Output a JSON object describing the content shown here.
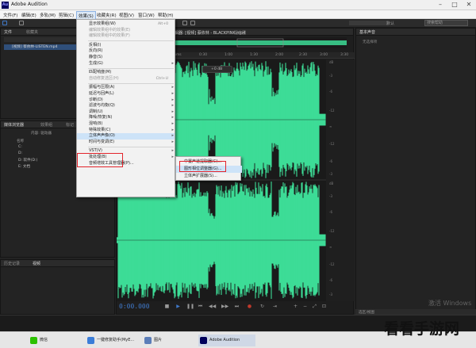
{
  "window": {
    "title": "Adobe Audition",
    "app_logo": "Au",
    "minimize": "–",
    "maximize": "□",
    "close": "✕"
  },
  "menubar": [
    {
      "label": "文件(F)"
    },
    {
      "label": "编辑(E)"
    },
    {
      "label": "多轨(M)"
    },
    {
      "label": "剪辑(C)"
    },
    {
      "label": "效果(S)"
    },
    {
      "label": "收藏夹(R)"
    },
    {
      "label": "视图(V)"
    },
    {
      "label": "窗口(W)"
    },
    {
      "label": "帮助(H)"
    }
  ],
  "toolbar": {
    "workspace": "默认",
    "search": "搜索帮助"
  },
  "files_panel": {
    "tabs": [
      "文件",
      "收藏夹"
    ],
    "file_item": "[视频] 蔡依林-LISTEN.mp4"
  },
  "media_panel": {
    "tabs": [
      "媒体浏览器",
      "效果组",
      "标记"
    ],
    "column_header": "内容: 驱动器",
    "tree": [
      "名称",
      "C:",
      "D:",
      "D: 软件(D:)",
      "E: 文档"
    ]
  },
  "history_panel": {
    "tabs": [
      "历史记录",
      "视频"
    ]
  },
  "editor": {
    "file_tab": "编辑器: [视频] 蔡依林 - BLACKPINK.mp4",
    "mixer_tab": "混音器",
    "timecode": "0:00.000",
    "zoom": "+0 dB",
    "ruler": [
      "hms",
      "0:30",
      "1:00",
      "1:30",
      "2:00",
      "2:30",
      "3:00",
      "3:30"
    ],
    "db_scale": [
      "dB",
      "-3",
      "-6",
      "-12",
      "∞",
      "-12",
      "-6",
      "-3",
      "dB",
      "-3",
      "-6",
      "-12",
      "∞",
      "-12",
      "-6",
      "-3"
    ]
  },
  "essential_panel": {
    "title": "基本声音",
    "subtitle": "无选择项",
    "footer": "选区/视图"
  },
  "effects_menu": {
    "items": [
      {
        "label": "显示效果组(W)",
        "shortcut": "Alt+0",
        "type": "item"
      },
      {
        "label": "编辑效果组中的效果(E)",
        "type": "item",
        "disabled": true
      },
      {
        "label": "编辑效果组中的效果(F)",
        "type": "item",
        "disabled": true
      },
      {
        "type": "sep"
      },
      {
        "label": "反相(I)",
        "type": "item"
      },
      {
        "label": "反向(R)",
        "type": "item"
      },
      {
        "label": "静音(S)",
        "type": "item"
      },
      {
        "label": "生成(G)",
        "type": "sub"
      },
      {
        "type": "sep"
      },
      {
        "label": "匹配响度(M)",
        "type": "item"
      },
      {
        "label": "自动修复选区(H)",
        "shortcut": "Ctrl+U",
        "type": "item",
        "disabled": true
      },
      {
        "type": "sep"
      },
      {
        "label": "振幅与压限(A)",
        "type": "sub"
      },
      {
        "label": "延迟与回声(L)",
        "type": "sub"
      },
      {
        "label": "诊断(D)",
        "type": "sub"
      },
      {
        "label": "滤波与均衡(Q)",
        "type": "sub"
      },
      {
        "label": "调制(U)",
        "type": "sub"
      },
      {
        "label": "降噪/恢复(N)",
        "type": "sub"
      },
      {
        "label": "混响(B)",
        "type": "sub"
      },
      {
        "label": "特殊效果(C)",
        "type": "sub"
      },
      {
        "label": "立体声声像(O)",
        "type": "sub",
        "highlight": true
      },
      {
        "label": "时间与变调(E)",
        "type": "sub"
      },
      {
        "type": "sep"
      },
      {
        "label": "VST(V)",
        "type": "sub"
      },
      {
        "label": "批处理(B)",
        "type": "sub"
      },
      {
        "label": "音频增效工具管理器(P)...",
        "type": "item"
      }
    ],
    "submenu": [
      {
        "label": "中置声道提取器(C)..."
      },
      {
        "label": "图形相位调整器(G)..."
      },
      {
        "label": "立体声扩展器(S)..."
      }
    ]
  },
  "watermark": "激活 Windows",
  "taskbar": [
    {
      "label": "微信",
      "color": "#2dc100"
    },
    {
      "label": "一键修复助手(MyE...",
      "color": "#3b7dd8"
    },
    {
      "label": "图片",
      "color": "#5b7db8"
    },
    {
      "label": "Adobe Audition",
      "color": "#00005b"
    }
  ],
  "logo_text": "看看手游网",
  "colors": {
    "waveform": "#3ddc97",
    "accent": "#3f78c8",
    "highlight_box": "#e3242b"
  }
}
